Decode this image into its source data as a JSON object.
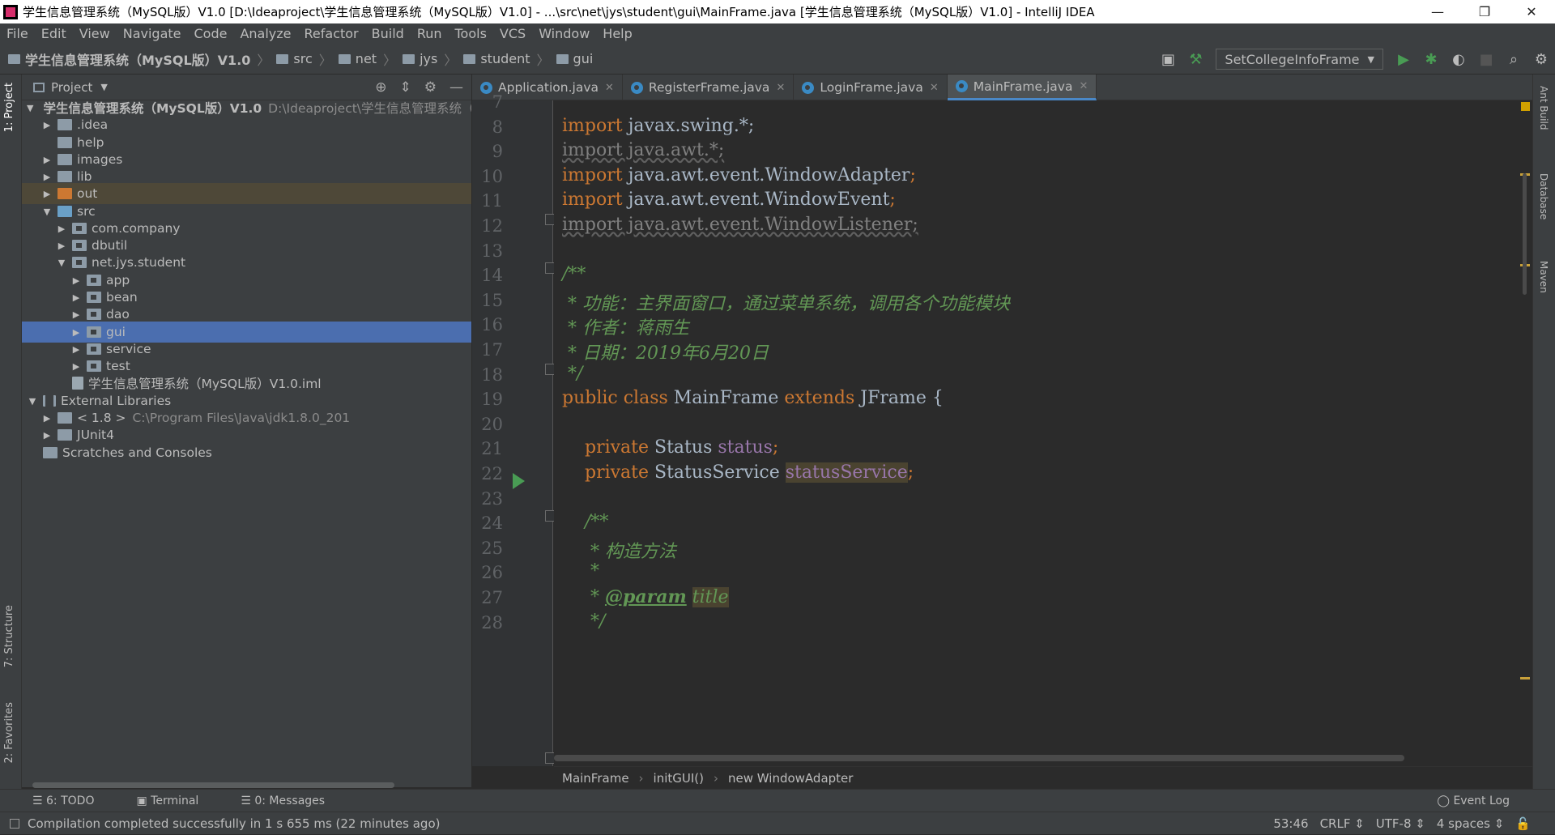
{
  "window": {
    "title": "学生信息管理系统（MySQL版）V1.0 [D:\\Ideaproject\\学生信息管理系统（MySQL版）V1.0] - ...\\src\\net\\jys\\student\\gui\\MainFrame.java [学生信息管理系统（MySQL版）V1.0] - IntelliJ IDEA",
    "min": "—",
    "max": "❐",
    "close": "✕"
  },
  "menu": [
    "File",
    "Edit",
    "View",
    "Navigate",
    "Code",
    "Analyze",
    "Refactor",
    "Build",
    "Run",
    "Tools",
    "VCS",
    "Window",
    "Help"
  ],
  "navbar": {
    "crumbs": [
      "学生信息管理系统（MySQL版）V1.0",
      "src",
      "net",
      "jys",
      "student",
      "gui"
    ],
    "run_config": "SetCollegeInfoFrame"
  },
  "project_panel": {
    "title": "Project",
    "tree": [
      {
        "label": "学生信息管理系统（MySQL版）V1.0",
        "extra": "D:\\Ideaproject\\学生信息管理系统（I",
        "depth": 0,
        "arrow": "▼",
        "icon": "fic"
      },
      {
        "label": ".idea",
        "extra": "",
        "depth": 1,
        "arrow": "▶",
        "icon": "fic"
      },
      {
        "label": "help",
        "extra": "",
        "depth": 1,
        "arrow": "",
        "icon": "fic"
      },
      {
        "label": "images",
        "extra": "",
        "depth": 1,
        "arrow": "▶",
        "icon": "fic"
      },
      {
        "label": "lib",
        "extra": "",
        "depth": 1,
        "arrow": "▶",
        "icon": "fic"
      },
      {
        "label": "out",
        "extra": "",
        "depth": 1,
        "arrow": "▶",
        "icon": "fic orange",
        "state": "out"
      },
      {
        "label": "src",
        "extra": "",
        "depth": 1,
        "arrow": "▼",
        "icon": "fic blue"
      },
      {
        "label": "com.company",
        "extra": "",
        "depth": 2,
        "arrow": "▶",
        "icon": "fic pkg"
      },
      {
        "label": "dbutil",
        "extra": "",
        "depth": 2,
        "arrow": "▶",
        "icon": "fic pkg"
      },
      {
        "label": "net.jys.student",
        "extra": "",
        "depth": 2,
        "arrow": "▼",
        "icon": "fic pkg"
      },
      {
        "label": "app",
        "extra": "",
        "depth": 3,
        "arrow": "▶",
        "icon": "fic pkg"
      },
      {
        "label": "bean",
        "extra": "",
        "depth": 3,
        "arrow": "▶",
        "icon": "fic pkg"
      },
      {
        "label": "dao",
        "extra": "",
        "depth": 3,
        "arrow": "▶",
        "icon": "fic pkg"
      },
      {
        "label": "gui",
        "extra": "",
        "depth": 3,
        "arrow": "▶",
        "icon": "fic pkg",
        "state": "sel"
      },
      {
        "label": "service",
        "extra": "",
        "depth": 3,
        "arrow": "▶",
        "icon": "fic pkg"
      },
      {
        "label": "test",
        "extra": "",
        "depth": 3,
        "arrow": "▶",
        "icon": "fic pkg"
      },
      {
        "label": "学生信息管理系统（MySQL版）V1.0.iml",
        "extra": "",
        "depth": 2,
        "arrow": "",
        "icon": "fic file"
      },
      {
        "label": "External Libraries",
        "extra": "",
        "depth": 0,
        "arrow": "▼",
        "icon": "fic lib"
      },
      {
        "label": "< 1.8 >",
        "extra": "C:\\Program Files\\Java\\jdk1.8.0_201",
        "depth": 1,
        "arrow": "▶",
        "icon": "fic"
      },
      {
        "label": "JUnit4",
        "extra": "",
        "depth": 1,
        "arrow": "▶",
        "icon": "fic"
      },
      {
        "label": "Scratches and Consoles",
        "extra": "",
        "depth": 0,
        "arrow": "",
        "icon": "fic"
      }
    ]
  },
  "tabs": [
    {
      "label": "Application.java",
      "active": false
    },
    {
      "label": "RegisterFrame.java",
      "active": false
    },
    {
      "label": "LoginFrame.java",
      "active": false
    },
    {
      "label": "MainFrame.java",
      "active": true
    }
  ],
  "editor": {
    "lines": [
      {
        "n": "7",
        "html": ""
      },
      {
        "n": "8",
        "html": "<span class=\"kw\">import</span> javax.swing.*;"
      },
      {
        "n": "9",
        "html": "<span class=\"unused\">import java.awt.*;</span>"
      },
      {
        "n": "10",
        "html": "<span class=\"kw\">import</span> java.awt.event.WindowAdapter<span class=\"kw\">;</span>"
      },
      {
        "n": "11",
        "html": "<span class=\"kw\">import</span> java.awt.event.WindowEvent<span class=\"kw\">;</span>"
      },
      {
        "n": "12",
        "html": "<span class=\"unused\">import java.awt.event.WindowListener;</span>"
      },
      {
        "n": "13",
        "html": ""
      },
      {
        "n": "14",
        "html": "<span class=\"cm\">/**</span>"
      },
      {
        "n": "15",
        "html": "<span class=\"cm\"> * 功能：主界面窗口，通过菜单系统，调用各个功能模块</span>"
      },
      {
        "n": "16",
        "html": "<span class=\"cm\"> * 作者：蒋雨生</span>"
      },
      {
        "n": "17",
        "html": "<span class=\"cm\"> * 日期：2019年6月20日</span>"
      },
      {
        "n": "18",
        "html": "<span class=\"cm\"> */</span>"
      },
      {
        "n": "19",
        "html": "<span class=\"kw\">public class</span> MainFrame <span class=\"kw\">extends</span> JFrame {"
      },
      {
        "n": "20",
        "html": ""
      },
      {
        "n": "21",
        "html": "    <span class=\"kw\">private</span> Status <span class=\"fld\">status</span><span class=\"kw\">;</span>"
      },
      {
        "n": "22",
        "html": "    <span class=\"kw\">private</span> StatusService <span class=\"fld hl\">statusService</span><span class=\"kw\">;</span>"
      },
      {
        "n": "23",
        "html": ""
      },
      {
        "n": "24",
        "html": "    <span class=\"cm\">/**</span>"
      },
      {
        "n": "25",
        "html": "<span class=\"cm\">     * 构造方法</span>"
      },
      {
        "n": "26",
        "html": "<span class=\"cm\">     *</span>"
      },
      {
        "n": "27",
        "html": "<span class=\"cm\">     * </span><span class=\"tag\">@param</span> <span class=\"cm hl\">title</span>"
      },
      {
        "n": "28",
        "html": "<span class=\"cm\">     */</span>"
      }
    ]
  },
  "breadcrumb": [
    "MainFrame",
    "initGUI()",
    "new WindowAdapter"
  ],
  "left_tool_tabs": [
    "1: Project",
    "7: Structure",
    "2: Favorites"
  ],
  "right_tool_tabs": [
    "Ant Build",
    "Database",
    "Maven"
  ],
  "bottom_tabs": [
    "6: TODO",
    "Terminal",
    "0: Messages"
  ],
  "event_log": "Event Log",
  "status": {
    "message": "Compilation completed successfully in 1 s 655 ms (22 minutes ago)",
    "position": "53:46",
    "line_sep": "CRLF ⇕",
    "encoding": "UTF-8 ⇕",
    "indent": "4 spaces ⇕"
  },
  "colors": {
    "accent": "#4a88c7",
    "selection": "#4b6eaf",
    "keyword": "#cc7832",
    "comment": "#629755"
  }
}
